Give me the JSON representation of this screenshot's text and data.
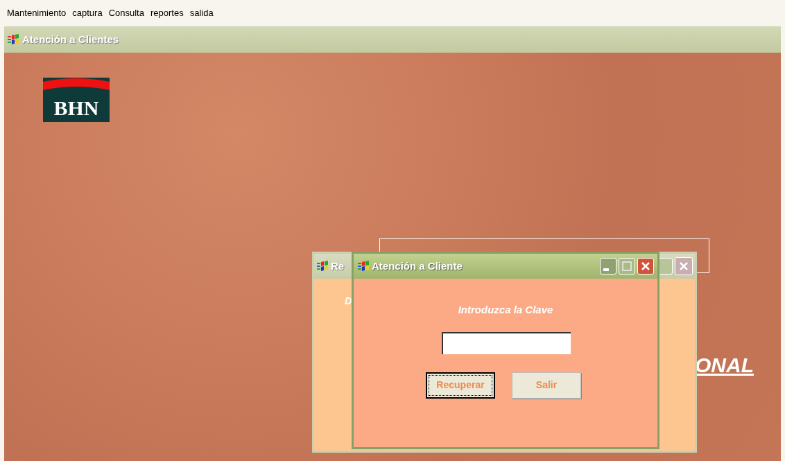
{
  "menu": [
    "Mantenimiento",
    "captura",
    "Consulta",
    "reportes",
    "salida"
  ],
  "window": {
    "title": "Atención a Clientes"
  },
  "logo": {
    "text": "BHN"
  },
  "side_text": "ONAL",
  "back_window": {
    "title": "Re",
    "body_text": "D"
  },
  "dialog": {
    "title": "Atención a Cliente",
    "prompt": "Introduzca la Clave",
    "buttons": [
      {
        "label": "Recuperar",
        "focused": true
      },
      {
        "label": "Salir",
        "focused": false
      }
    ]
  }
}
